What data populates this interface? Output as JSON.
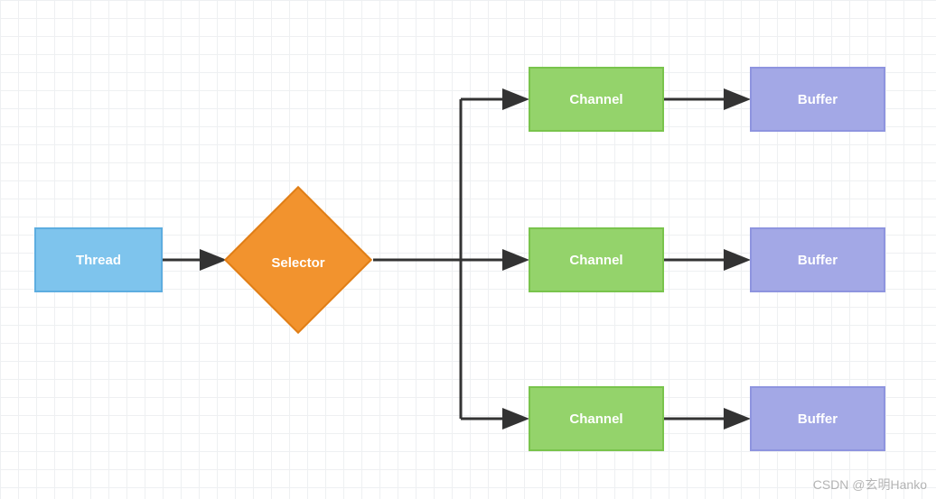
{
  "diagram": {
    "thread": {
      "label": "Thread"
    },
    "selector": {
      "label": "Selector"
    },
    "channels": [
      {
        "label": "Channel"
      },
      {
        "label": "Channel"
      },
      {
        "label": "Channel"
      }
    ],
    "buffers": [
      {
        "label": "Buffer"
      },
      {
        "label": "Buffer"
      },
      {
        "label": "Buffer"
      }
    ]
  },
  "watermark": "CSDN @玄明Hanko",
  "colors": {
    "thread_fill": "#7ec4ed",
    "selector_fill": "#f2932e",
    "channel_fill": "#94d36b",
    "buffer_fill": "#a3a8e6",
    "grid": "#eef0f2",
    "arrow": "#333333"
  }
}
